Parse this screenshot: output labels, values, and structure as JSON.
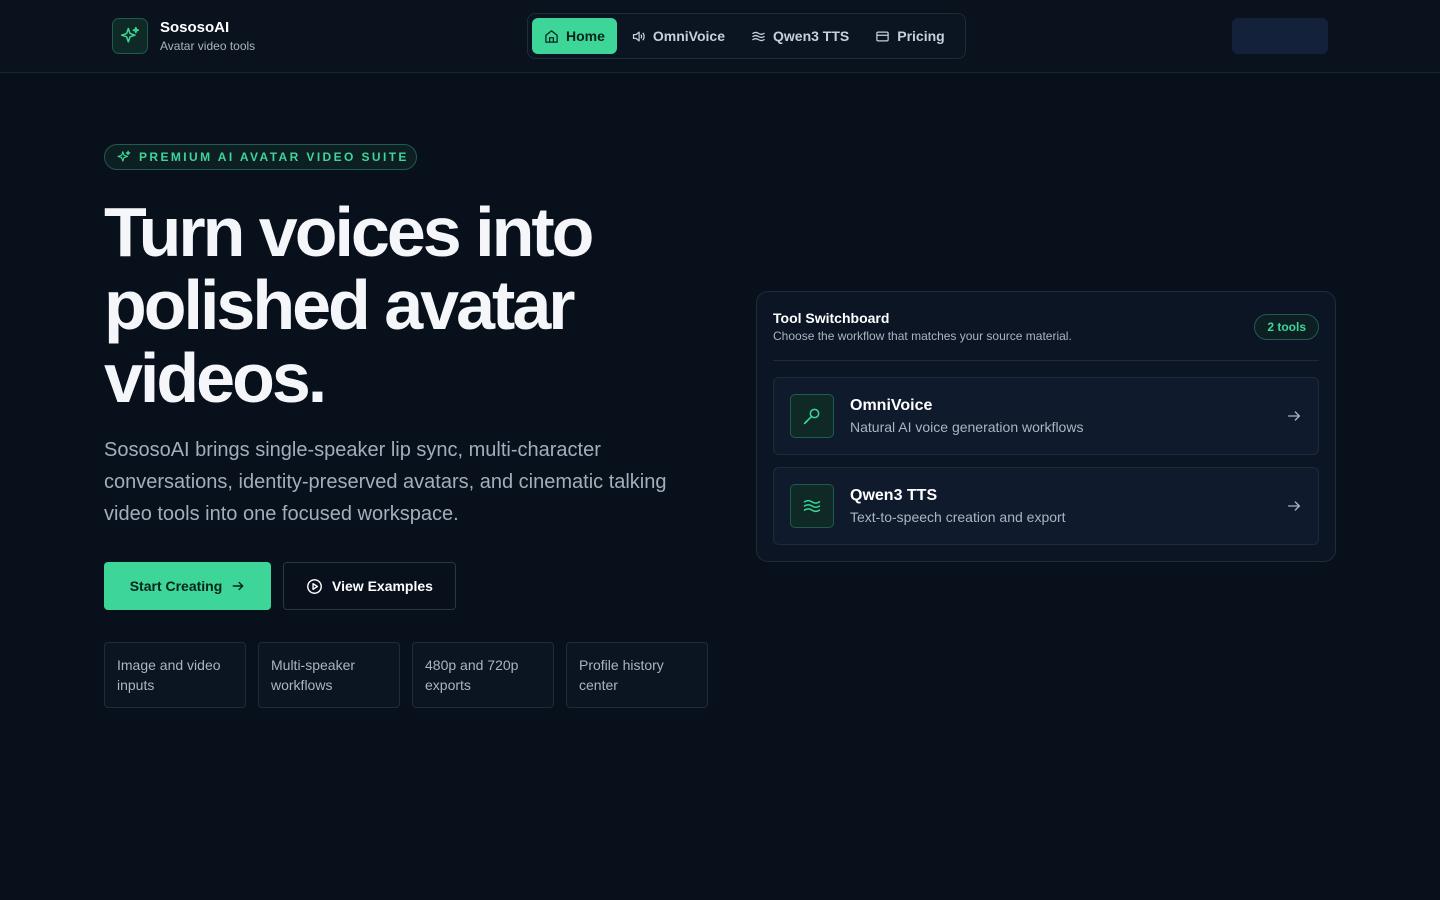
{
  "brand": {
    "name": "SososoAI",
    "tagline": "Avatar video tools"
  },
  "nav": {
    "items": [
      {
        "label": "Home",
        "icon": "home-icon",
        "active": true
      },
      {
        "label": "OmniVoice",
        "icon": "speaker-icon",
        "active": false
      },
      {
        "label": "Qwen3 TTS",
        "icon": "waves-icon",
        "active": false
      },
      {
        "label": "Pricing",
        "icon": "card-icon",
        "active": false
      }
    ]
  },
  "hero": {
    "badge": "PREMIUM AI AVATAR VIDEO SUITE",
    "headline": "Turn voices into polished avatar videos.",
    "lede": "SososoAI brings single-speaker lip sync, multi-character conversations, identity-preserved avatars, and cinematic talking video tools into one focused workspace.",
    "primary_cta": "Start Creating",
    "secondary_cta": "View Examples",
    "features": [
      "Image and video inputs",
      "Multi-speaker workflows",
      "480p and 720p exports",
      "Profile history center"
    ]
  },
  "switchboard": {
    "title": "Tool Switchboard",
    "subtitle": "Choose the workflow that matches your source material.",
    "count": "2 tools",
    "tools": [
      {
        "name": "OmniVoice",
        "description": "Natural AI voice generation workflows",
        "icon": "microphone-icon"
      },
      {
        "name": "Qwen3 TTS",
        "description": "Text-to-speech creation and export",
        "icon": "waves-icon"
      }
    ]
  },
  "colors": {
    "accent": "#3dd598",
    "background": "#08101c",
    "surface": "#0b1524"
  }
}
